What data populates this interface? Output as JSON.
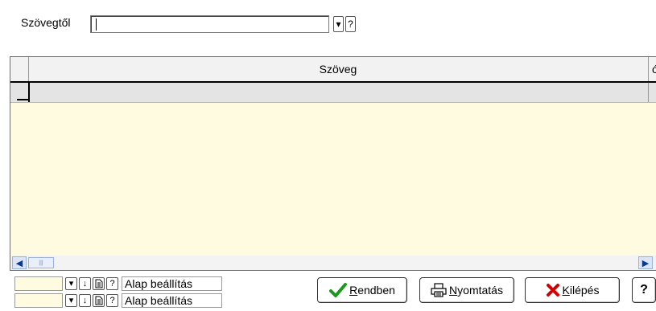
{
  "filter": {
    "label": "Szövegtől",
    "value": "",
    "dropdown_glyph": "▾",
    "help_glyph": "?"
  },
  "grid": {
    "columns": [
      "Szöveg",
      "ó"
    ],
    "rows": [
      [
        "",
        ""
      ]
    ]
  },
  "settings": [
    {
      "value": "",
      "label": "Alap beállítás"
    },
    {
      "value": "",
      "label": "Alap beállítás"
    }
  ],
  "actions": {
    "ok_label": "Rendben",
    "print_label": "Nyomtatás",
    "exit_label": "Kilépés",
    "help_label": "?"
  },
  "icons": {
    "ok": "checkmark-icon",
    "print": "printer-icon",
    "exit": "red-x-icon"
  },
  "colors": {
    "grid_background": "#fffbe0",
    "check_green": "#1a9a1a",
    "exit_red": "#d40000"
  }
}
